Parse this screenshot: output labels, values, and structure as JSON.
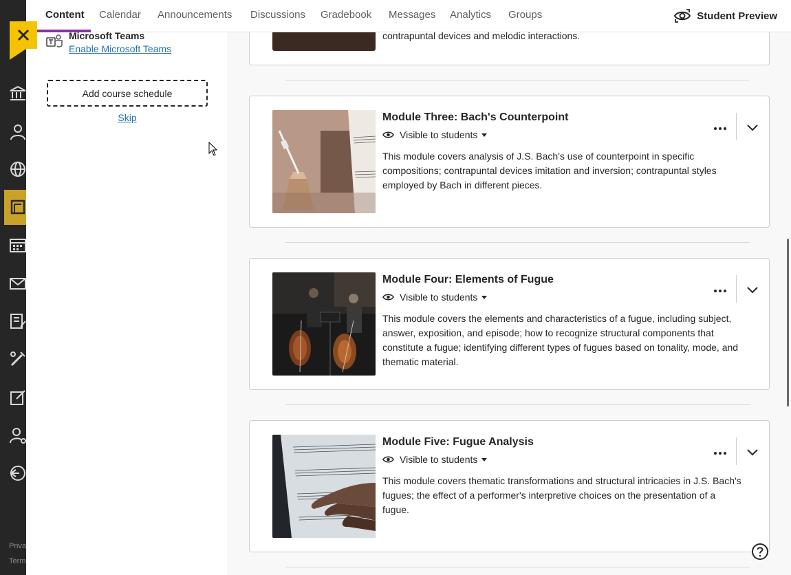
{
  "tabs": [
    {
      "label": "Content"
    },
    {
      "label": "Calendar"
    },
    {
      "label": "Announcements"
    },
    {
      "label": "Discussions"
    },
    {
      "label": "Gradebook"
    },
    {
      "label": "Messages"
    },
    {
      "label": "Analytics"
    },
    {
      "label": "Groups"
    }
  ],
  "student_preview": {
    "label": "Student Preview"
  },
  "sidebar": {
    "teams_title": "Microsoft Teams",
    "teams_link": "Enable Microsoft Teams",
    "schedule_button": "Add course schedule",
    "skip_link": "Skip"
  },
  "app_nav": {
    "footer_1": "Priva",
    "footer_2": "Term"
  },
  "modules": [
    {
      "partial_text": "contrapuntal devices and melodic interactions."
    },
    {
      "title": "Module Three: Bach's Counterpoint",
      "visibility": "Visible to students",
      "description": "This module covers analysis of J.S. Bach's use of counterpoint in specific compositions; contrapuntal devices imitation and inversion; contrapuntal styles employed by Bach in different pieces."
    },
    {
      "title": "Module Four: Elements of Fugue",
      "visibility": "Visible to students",
      "description": "This module covers the elements and characteristics of a fugue, including subject, answer, exposition, and episode; how to recognize structural components that constitute a fugue; identifying different types of fugues based on tonality, mode, and thematic material."
    },
    {
      "title": "Module Five: Fugue Analysis",
      "visibility": "Visible to students",
      "description": "This module covers thematic transformations and structural intricacies in J.S. Bach's fugues; the effect of a performer's interpretive choices on the presentation of a fugue."
    }
  ],
  "colors": {
    "accent_tab": "#8b2fa8",
    "close_yellow": "#f5c400",
    "link_blue": "#1f6fb2",
    "nav_dark": "#262626"
  }
}
